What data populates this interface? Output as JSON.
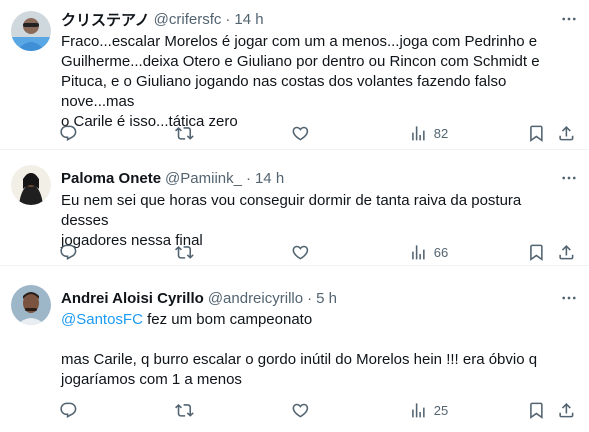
{
  "tweets": [
    {
      "name": "クリステアノ",
      "handle": "@crifersfc",
      "dot": "·",
      "time": "14 h",
      "text_lines": [
        "Fraco...escalar Morelos é jogar com um a menos...joga com Pedrinho e",
        "Guilherme...deixa Otero e Giuliano por dentro ou Rincon com Schmidt e",
        "Pituca, e o Giuliano jogando nas costas dos volantes fazendo falso nove...mas",
        "o Carile é isso...tática zero"
      ],
      "views": "82"
    },
    {
      "name": "Paloma Onete",
      "handle": "@Pamiink_",
      "dot": "·",
      "time": "14 h",
      "text_lines": [
        "Eu nem sei que horas vou conseguir dormir de tanta raiva da postura desses",
        "jogadores nessa final"
      ],
      "views": "66"
    },
    {
      "name": "Andrei Aloisi Cyrillo",
      "handle": "@andreicyrillo",
      "dot": "·",
      "time": "5 h",
      "mention": "@SantosFC",
      "first_line_rest": " fez um bom campeonato",
      "text_lines": [
        "mas Carile, q burro escalar o gordo inútil do Morelos hein !!! era óbvio q",
        "jogaríamos com 1 a menos"
      ],
      "views": "25"
    }
  ],
  "icons": {
    "more": "more-horizontal-icon",
    "reply": "reply-icon",
    "retweet": "retweet-icon",
    "like": "like-icon",
    "views": "views-icon",
    "bookmark": "bookmark-icon",
    "share": "share-icon"
  },
  "colors": {
    "text": "#0f1419",
    "secondary": "#536471",
    "link": "#1d9bf0",
    "divider": "#eff3f4"
  }
}
